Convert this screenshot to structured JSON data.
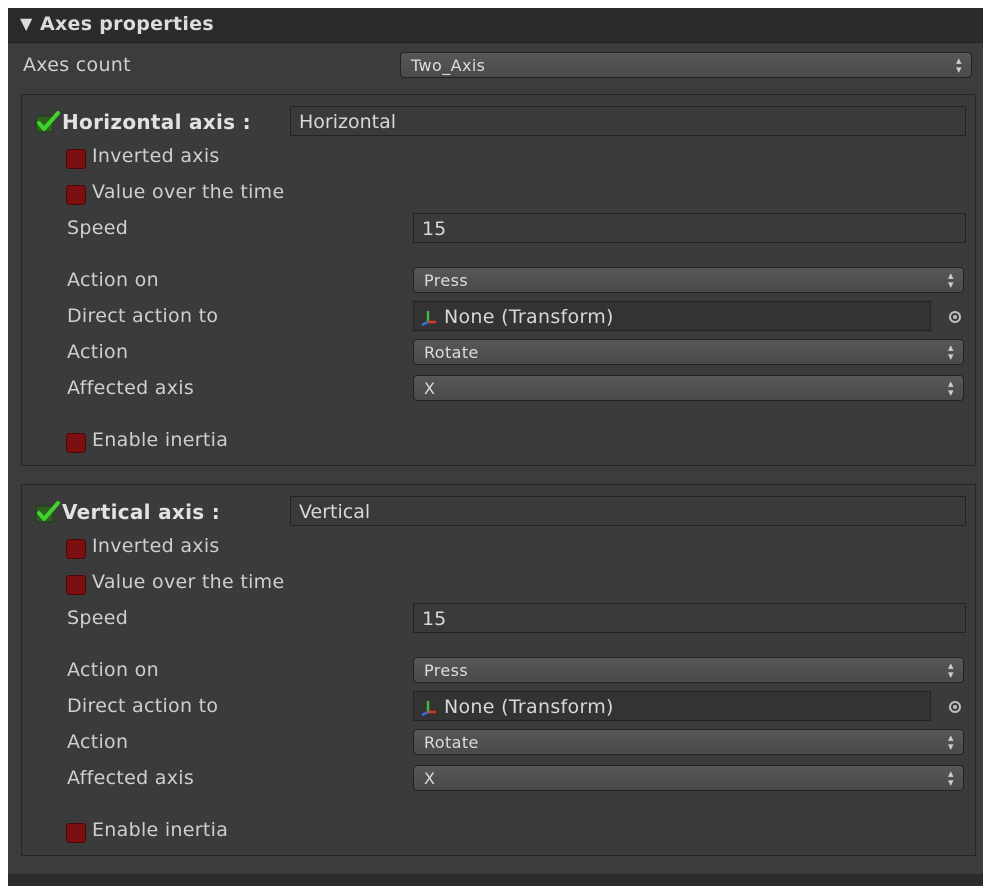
{
  "header": {
    "title": "Axes properties"
  },
  "axes_count": {
    "label": "Axes count",
    "value": "Two_Axis"
  },
  "horizontal": {
    "title": "Horizontal axis :",
    "name_value": "Horizontal",
    "inverted_label": "Inverted axis",
    "value_over_time_label": "Value over the time",
    "speed_label": "Speed",
    "speed_value": "15",
    "action_on_label": "Action on",
    "action_on_value": "Press",
    "direct_action_label": "Direct action to",
    "direct_action_value": "None (Transform)",
    "action_label": "Action",
    "action_value": "Rotate",
    "affected_axis_label": "Affected axis",
    "affected_axis_value": "X",
    "enable_inertia_label": "Enable inertia"
  },
  "vertical": {
    "title": "Vertical axis :",
    "name_value": "Vertical",
    "inverted_label": "Inverted axis",
    "value_over_time_label": "Value over the time",
    "speed_label": "Speed",
    "speed_value": "15",
    "action_on_label": "Action on",
    "action_on_value": "Press",
    "direct_action_label": "Direct action to",
    "direct_action_value": "None (Transform)",
    "action_label": "Action",
    "action_value": "Rotate",
    "affected_axis_label": "Affected axis",
    "affected_axis_value": "X",
    "enable_inertia_label": "Enable inertia"
  },
  "colors": {
    "panel": "#3c3c3c",
    "checkbox_off": "#7a1010",
    "check_on": "#3fd22a"
  }
}
